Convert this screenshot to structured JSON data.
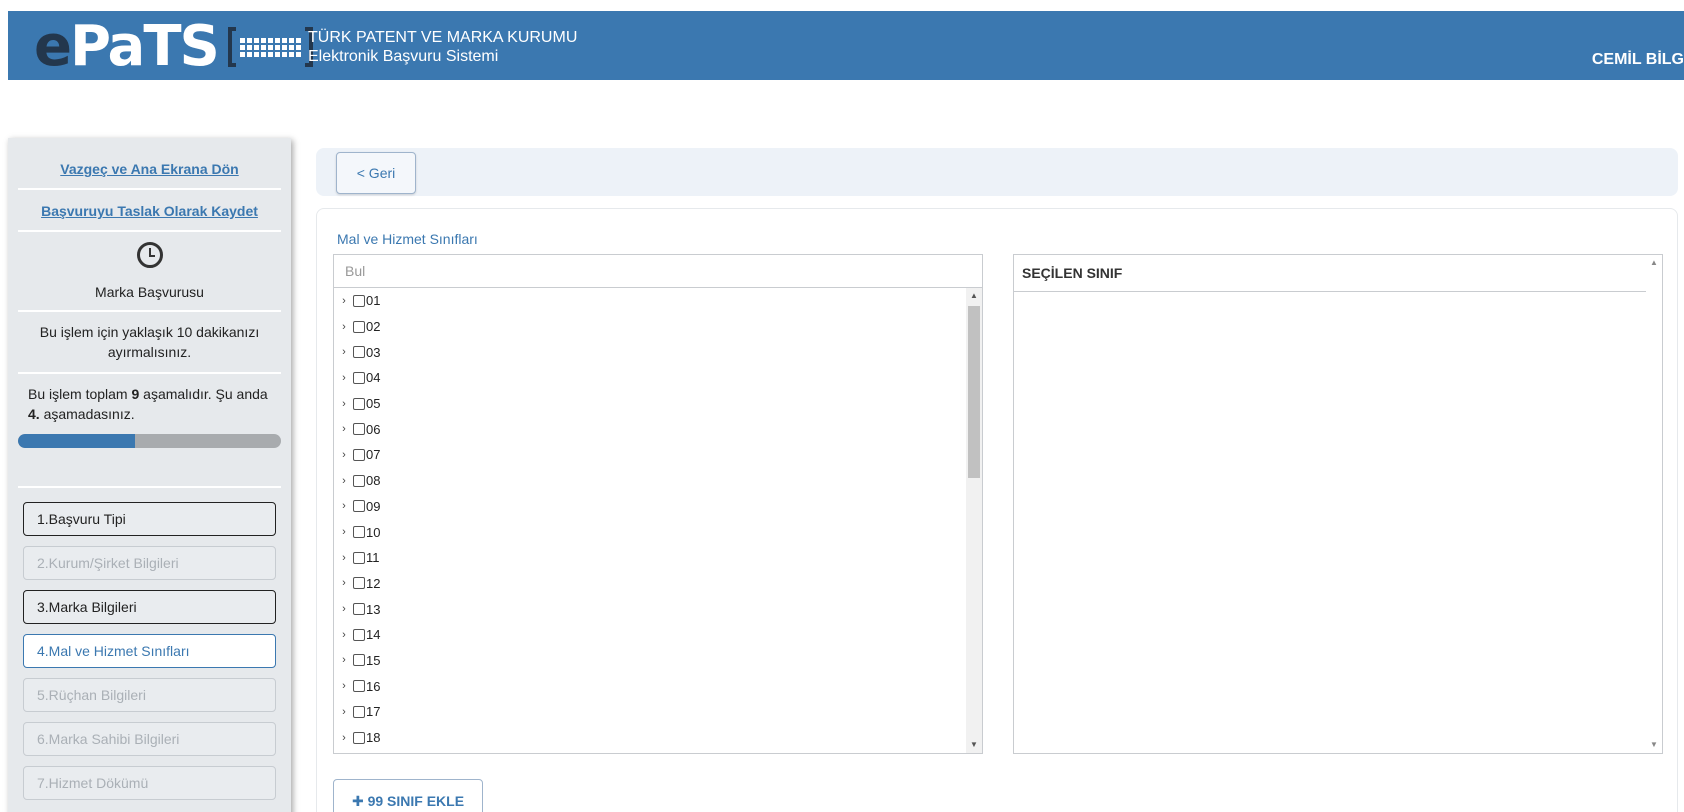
{
  "header": {
    "org_line1": "TÜRK PATENT VE MARKA KURUMU",
    "org_line2": "Elektronik Başvuru Sistemi",
    "user": "CEMİL BİLG",
    "brand_color": "#3b78b0"
  },
  "sidebar": {
    "cancel_link": "Vazgeç ve Ana Ekrana Dön",
    "save_draft_link": "Başvuruyu Taslak Olarak Kaydet",
    "title": "Marka Başvurusu",
    "time_info": "Bu işlem için yaklaşık 10 dakikanızı ayırmalısınız.",
    "step_text_a": "Bu işlem toplam ",
    "step_total": "9",
    "step_text_b": " aşamalıdır. Şu anda ",
    "step_current": "4.",
    "step_text_c": " aşamadasınız.",
    "progress_fraction": 0.444,
    "steps": [
      {
        "label": "1.Başvuru Tipi",
        "state": "done"
      },
      {
        "label": "2.Kurum/Şirket Bilgileri",
        "state": "disabled"
      },
      {
        "label": "3.Marka Bilgileri",
        "state": "done"
      },
      {
        "label": "4.Mal ve Hizmet Sınıfları",
        "state": "active"
      },
      {
        "label": "5.Rüçhan Bilgileri",
        "state": "disabled"
      },
      {
        "label": "6.Marka Sahibi Bilgileri",
        "state": "disabled"
      },
      {
        "label": "7.Hizmet Dökümü",
        "state": "disabled"
      }
    ]
  },
  "main": {
    "back_label": "< Geri",
    "section_label": "Mal ve Hizmet Sınıfları",
    "search_placeholder": "Bul",
    "classes": [
      "01",
      "02",
      "03",
      "04",
      "05",
      "06",
      "07",
      "08",
      "09",
      "10",
      "11",
      "12",
      "13",
      "14",
      "15",
      "16",
      "17",
      "18"
    ],
    "selected_header": "SEÇİLEN SINIF",
    "add_button": "99 SINIF EKLE"
  }
}
